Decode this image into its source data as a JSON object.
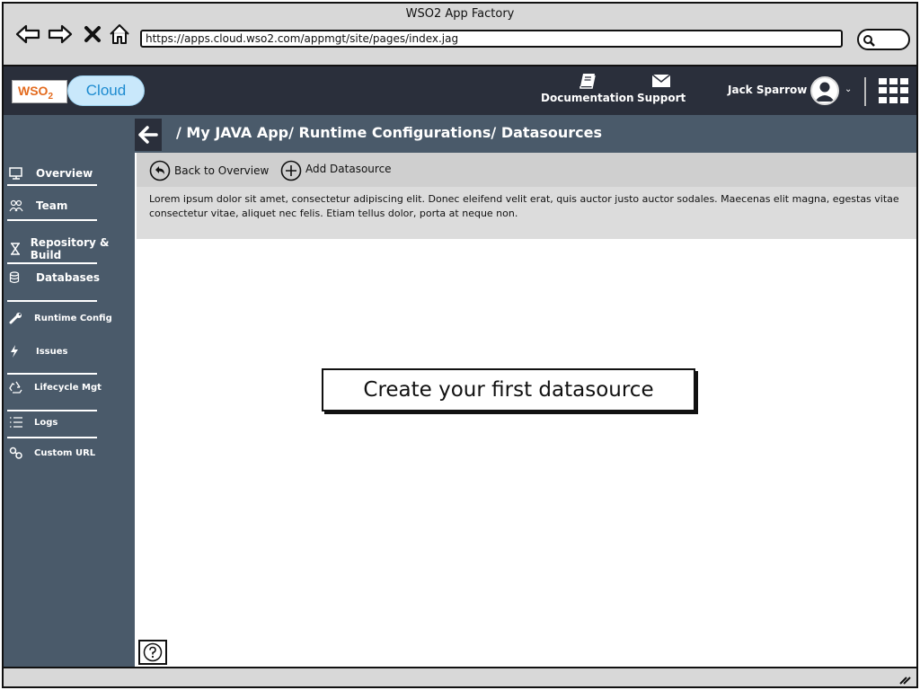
{
  "window": {
    "title": "WSO2 App Factory"
  },
  "browser": {
    "url": "https://apps.cloud.wso2.com/appmgt/site/pages/index.jag",
    "back_icon": "arrow-left-icon",
    "forward_icon": "arrow-right-icon",
    "stop_icon": "close-icon",
    "home_icon": "home-icon"
  },
  "header": {
    "logo": {
      "wso2": "WSO",
      "wso2_sub": "2",
      "cloud": "Cloud"
    },
    "documentation_label": "Documentation",
    "support_label": "Support",
    "user_name": "Jack Sparrow"
  },
  "breadcrumb": "/ My JAVA App/ Runtime Configurations/ Datasources",
  "sidebar": {
    "items": [
      {
        "label": "Overview",
        "icon": "monitor-icon"
      },
      {
        "label": "Team",
        "icon": "team-icon"
      },
      {
        "label": "Repository & Build",
        "icon": "hourglass-icon"
      },
      {
        "label": "Databases",
        "icon": "database-icon"
      },
      {
        "label": "Runtime Config",
        "icon": "wrench-icon"
      },
      {
        "label": "Issues",
        "icon": "bolt-icon"
      },
      {
        "label": "Lifecycle Mgt",
        "icon": "recycle-icon"
      },
      {
        "label": "Logs",
        "icon": "list-icon"
      },
      {
        "label": "Custom URL",
        "icon": "link-icon"
      }
    ]
  },
  "toolbar": {
    "back_label": "Back to Overview",
    "add_label": "Add Datasource"
  },
  "description": "Lorem ipsum dolor sit amet, consectetur adipiscing elit. Donec eleifend velit erat, quis auctor justo auctor sodales. Maecenas elit magna, egestas vitae consectetur vitae, aliquet nec felis. Etiam tellus dolor, porta at neque non.",
  "main": {
    "create_label": "Create your first datasource"
  },
  "colors": {
    "header_bg": "#2a2f3b",
    "sidebar_bg": "#4a5a6a",
    "toolbar_bg": "#cfcfcf",
    "desc_bg": "#dcdcdc"
  }
}
